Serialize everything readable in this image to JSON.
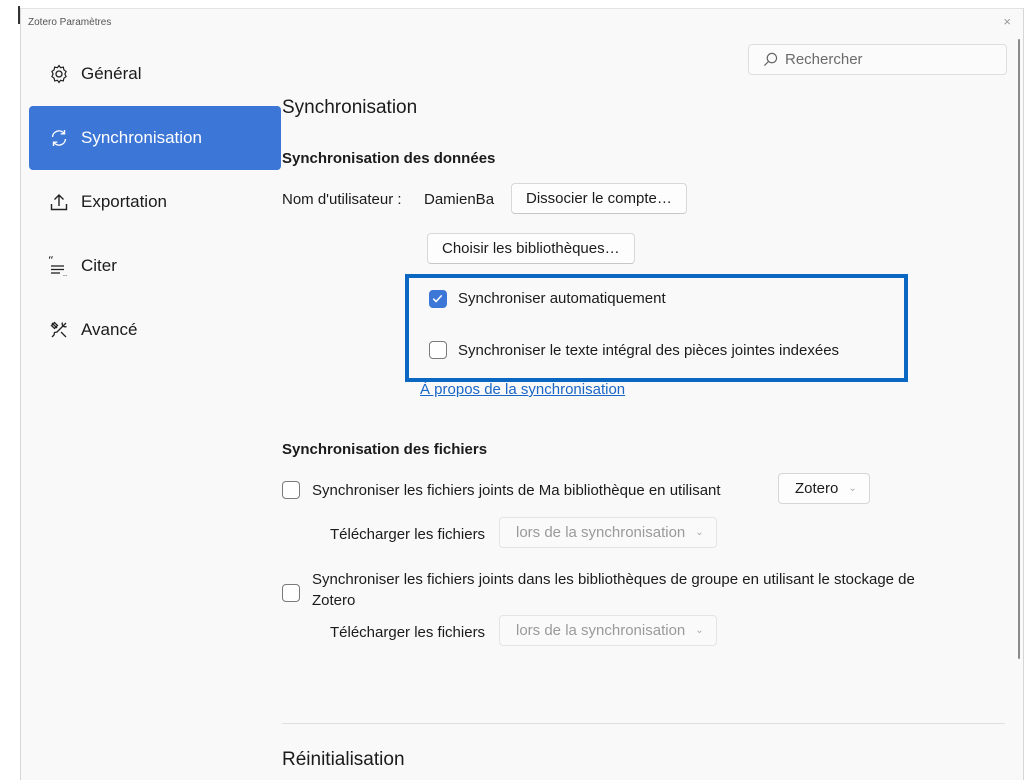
{
  "window": {
    "title": "Zotero Paramètres",
    "close": "×"
  },
  "search": {
    "placeholder": "Rechercher"
  },
  "sidebar": {
    "items": [
      {
        "label": "Général",
        "icon": "gear-icon"
      },
      {
        "label": "Synchronisation",
        "icon": "sync-icon",
        "active": true
      },
      {
        "label": "Exportation",
        "icon": "export-icon"
      },
      {
        "label": "Citer",
        "icon": "cite-icon"
      },
      {
        "label": "Avancé",
        "icon": "tools-icon"
      }
    ]
  },
  "sync": {
    "section_title": "Synchronisation",
    "data_heading": "Synchronisation des données",
    "username_label": "Nom d'utilisateur :",
    "username_value": "DamienBa",
    "unlink_button": "Dissocier le compte…",
    "choose_libraries_button": "Choisir les bibliothèques…",
    "auto_sync": {
      "label": "Synchroniser automatiquement",
      "checked": true
    },
    "fulltext_sync": {
      "label": "Synchroniser le texte intégral des pièces jointes indexées",
      "checked": false
    },
    "about_link": "À propos de la synchronisation"
  },
  "files": {
    "heading": "Synchronisation des fichiers",
    "my_library": {
      "label": "Synchroniser les fichiers joints de Ma bibliothèque en utilisant",
      "checked": false,
      "storage_value": "Zotero",
      "download_label": "Télécharger les fichiers",
      "download_value": "lors de la synchronisation"
    },
    "group_libraries": {
      "label_line1": "Synchroniser les fichiers joints dans les bibliothèques de groupe en utilisant le stockage de",
      "label_line2": "Zotero",
      "checked": false,
      "download_label": "Télécharger les fichiers",
      "download_value": "lors de la synchronisation"
    }
  },
  "reset": {
    "section_title": "Réinitialisation"
  },
  "colors": {
    "accent": "#3c76d6",
    "highlight_border": "#0a68c2",
    "link": "#1a66c7"
  }
}
